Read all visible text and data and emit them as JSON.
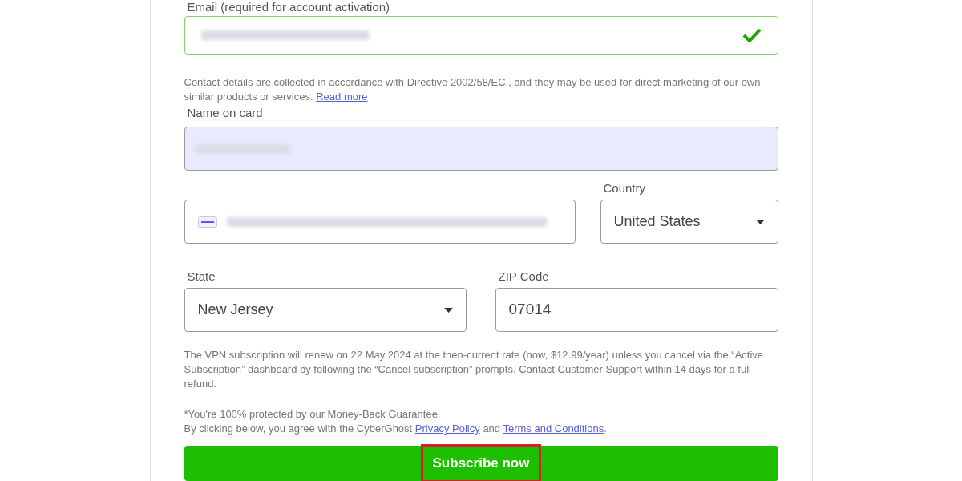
{
  "email": {
    "label": "Email (required for account activation)",
    "valid": true
  },
  "consent": {
    "text": "Contact details are collected in accordance with Directive 2002/58/EC., and they may be used for direct marketing of our own similar products or services.",
    "link": "Read more"
  },
  "name_on_card": {
    "label": "Name on card",
    "autofilled": true
  },
  "country": {
    "label": "Country",
    "value": "United States"
  },
  "state": {
    "label": "State",
    "value": "New Jersey"
  },
  "zip": {
    "label": "ZIP Code",
    "value": "07014"
  },
  "renewal_notice": "The VPN subscription will renew on 22 May 2024 at the then-current rate (now, $12.99/year) unless you cancel via the “Active Subscription” dashboard by following the “Cancel subscription” prompts. Contact Customer Support within 14 days for a full refund.",
  "guarantee": "*You're 100% protected by our Money-Back Guarantee.",
  "agreement": {
    "text": "By clicking below, you agree with the CyberGhost",
    "privacy_link": "Privacy Policy",
    "and": "and",
    "terms_link": "Terms and Conditions",
    "end": "."
  },
  "subscribe_button": {
    "label": "Subscribe now",
    "highlighted": true
  }
}
